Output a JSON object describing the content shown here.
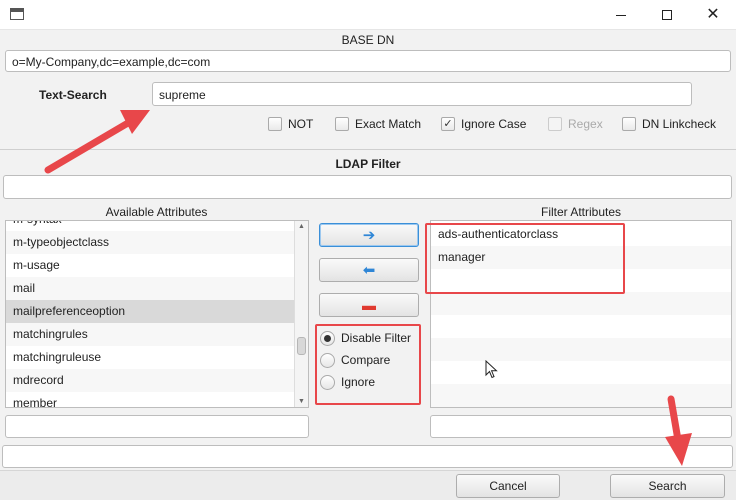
{
  "window": {
    "minimize_glyph": "—",
    "maximize_glyph": "☐",
    "close_glyph": "✕"
  },
  "base_dn": {
    "label": "BASE DN",
    "value": "o=My-Company,dc=example,dc=com"
  },
  "text_search": {
    "label": "Text-Search",
    "value": "supreme"
  },
  "options": {
    "not": {
      "label": "NOT",
      "checked": false
    },
    "exact_match": {
      "label": "Exact Match",
      "checked": false
    },
    "ignore_case": {
      "label": "Ignore Case",
      "checked": true,
      "check_glyph": "✓"
    },
    "regex": {
      "label": "Regex",
      "checked": false,
      "disabled": true
    },
    "dn_linkcheck": {
      "label": "DN Linkcheck",
      "checked": false
    }
  },
  "ldap_filter": {
    "label": "LDAP Filter",
    "value": ""
  },
  "available_attributes": {
    "header": "Available Attributes",
    "items": [
      "m-syntax",
      "m-typeobjectclass",
      "m-usage",
      "mail",
      "mailpreferenceoption",
      "matchingrules",
      "matchingruleuse",
      "mdrecord",
      "member"
    ],
    "selected": "mailpreferenceoption",
    "search_value": ""
  },
  "filter_attributes": {
    "header": "Filter Attributes",
    "items": [
      "ads-authenticatorclass",
      "manager",
      "",
      "",
      "",
      "",
      "",
      ""
    ],
    "search_value": ""
  },
  "transfer_buttons": {
    "add": "➔",
    "remove": "⬅",
    "clear": "▬"
  },
  "filter_mode": {
    "options": [
      "Disable Filter",
      "Compare",
      "Ignore"
    ],
    "selected": "Disable Filter"
  },
  "status_value": "",
  "actions": {
    "cancel": "Cancel",
    "search": "Search"
  },
  "colors": {
    "accent_blue": "#2f86d6",
    "annotation_red": "#e8474a"
  }
}
